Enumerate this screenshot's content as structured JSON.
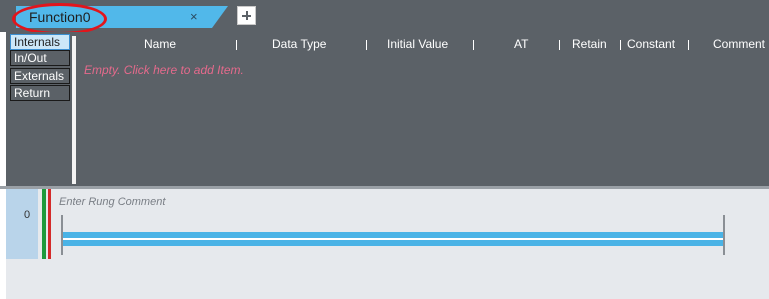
{
  "editor_tab": {
    "label": "Function0",
    "close_symbol": "×"
  },
  "colors": {
    "accent": "#51b8ea",
    "panel_bg": "#5b6167",
    "highlight_ring": "#e2151c",
    "empty_text": "#e46a8c",
    "power_green": "#1e9a3c",
    "power_red": "#d42a2a"
  },
  "icons": [
    "close-icon",
    "plus-icon"
  ],
  "variable_tabs": [
    {
      "label": "Internals",
      "active": true
    },
    {
      "label": "In/Out",
      "active": false
    },
    {
      "label": "Externals",
      "active": false
    },
    {
      "label": "Return",
      "active": false
    }
  ],
  "variable_table": {
    "columns": [
      "Name",
      "Data Type",
      "Initial Value",
      "AT",
      "Retain",
      "Constant",
      "Comment"
    ],
    "empty_message": "Empty. Click here to add Item."
  },
  "ladder": {
    "rung_number": "0",
    "rung_comment_placeholder": "Enter Rung Comment"
  }
}
